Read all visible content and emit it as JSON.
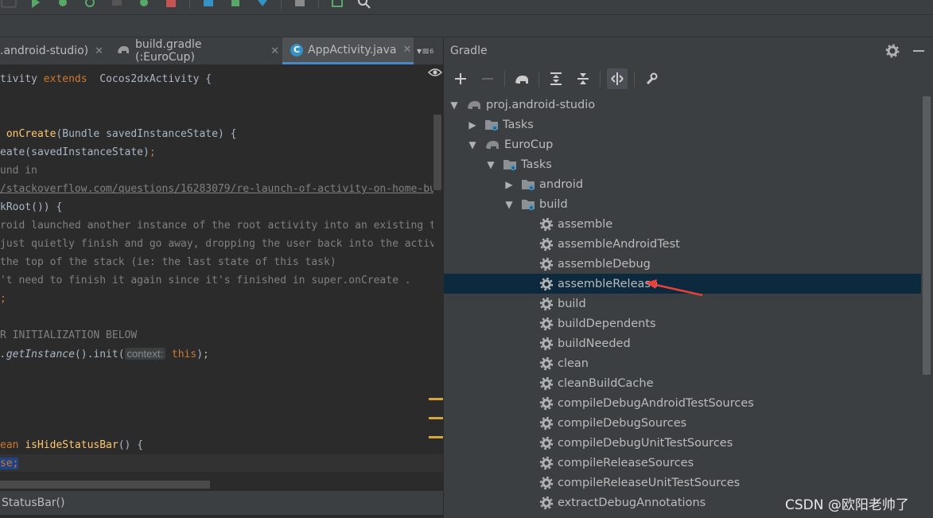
{
  "editor": {
    "tabs": [
      {
        "label": ".android-studio)",
        "active": false
      },
      {
        "label": "build.gradle (:EuroCup)",
        "active": false
      },
      {
        "label": "AppActivity.java",
        "active": true
      }
    ],
    "tab_overflow": "6",
    "code_lines": {
      "l1a": "tivity ",
      "l1b": "extends",
      "l1c": "  Cocos2dxActivity {",
      "l2a": " ",
      "l2b": "onCreate",
      "l2c": "(Bundle savedInstanceState) {",
      "l3a": "eate(savedInstanceState)",
      "l3b": ";",
      "l4": "und in",
      "l5": "/stackoverflow.com/questions/16283079/re-launch-of-activity-on-home-bu",
      "l6": "kRoot()) {",
      "l7": "roid launched another instance of the root activity into an existing t",
      "l8": "just quietly finish and go away, dropping the user back into the activ",
      "l9": "the top of the stack (ie: the last state of this task)",
      "l10": "'t need to finish it again since it's finished in super.onCreate .",
      "l11": ";",
      "l12": "R INITIALIZATION BELOW",
      "l13a": ".getInstance",
      "l13b": "().init(",
      "l13c": "context:",
      "l13d": "this",
      "l13e": ");",
      "l14a": "ean ",
      "l14b": "isHideStatusBar",
      "l14c": "() {",
      "l15a": "se",
      "l15b": ";"
    },
    "breadcrumb": "StatusBar()"
  },
  "gradle": {
    "title": "Gradle",
    "tree": [
      {
        "label": "proj.android-studio",
        "depth": 0,
        "expanded": true,
        "icon": "gradle-elephant-icon"
      },
      {
        "label": "Tasks",
        "depth": 1,
        "expanded": false,
        "icon": "tasks-folder-icon"
      },
      {
        "label": "EuroCup",
        "depth": 1,
        "expanded": true,
        "icon": "gradle-elephant-icon"
      },
      {
        "label": "Tasks",
        "depth": 2,
        "expanded": true,
        "icon": "tasks-folder-icon"
      },
      {
        "label": "android",
        "depth": 3,
        "expanded": false,
        "icon": "tasks-folder-icon"
      },
      {
        "label": "build",
        "depth": 3,
        "expanded": true,
        "icon": "tasks-folder-icon"
      },
      {
        "label": "assemble",
        "depth": 4,
        "icon": "gear-icon"
      },
      {
        "label": "assembleAndroidTest",
        "depth": 4,
        "icon": "gear-icon"
      },
      {
        "label": "assembleDebug",
        "depth": 4,
        "icon": "gear-icon"
      },
      {
        "label": "assembleRelease",
        "depth": 4,
        "icon": "gear-icon",
        "selected": true
      },
      {
        "label": "build",
        "depth": 4,
        "icon": "gear-icon"
      },
      {
        "label": "buildDependents",
        "depth": 4,
        "icon": "gear-icon"
      },
      {
        "label": "buildNeeded",
        "depth": 4,
        "icon": "gear-icon"
      },
      {
        "label": "clean",
        "depth": 4,
        "icon": "gear-icon"
      },
      {
        "label": "cleanBuildCache",
        "depth": 4,
        "icon": "gear-icon"
      },
      {
        "label": "compileDebugAndroidTestSources",
        "depth": 4,
        "icon": "gear-icon"
      },
      {
        "label": "compileDebugSources",
        "depth": 4,
        "icon": "gear-icon"
      },
      {
        "label": "compileDebugUnitTestSources",
        "depth": 4,
        "icon": "gear-icon"
      },
      {
        "label": "compileReleaseSources",
        "depth": 4,
        "icon": "gear-icon"
      },
      {
        "label": "compileReleaseUnitTestSources",
        "depth": 4,
        "icon": "gear-icon"
      },
      {
        "label": "extractDebugAnnotations",
        "depth": 4,
        "icon": "gear-icon"
      }
    ]
  },
  "watermark": "CSDN @欧阳老帅了",
  "colors": {
    "selection": "#0d293e",
    "accent": "#4a88c7",
    "annotation_arrow": "#e8403a"
  }
}
